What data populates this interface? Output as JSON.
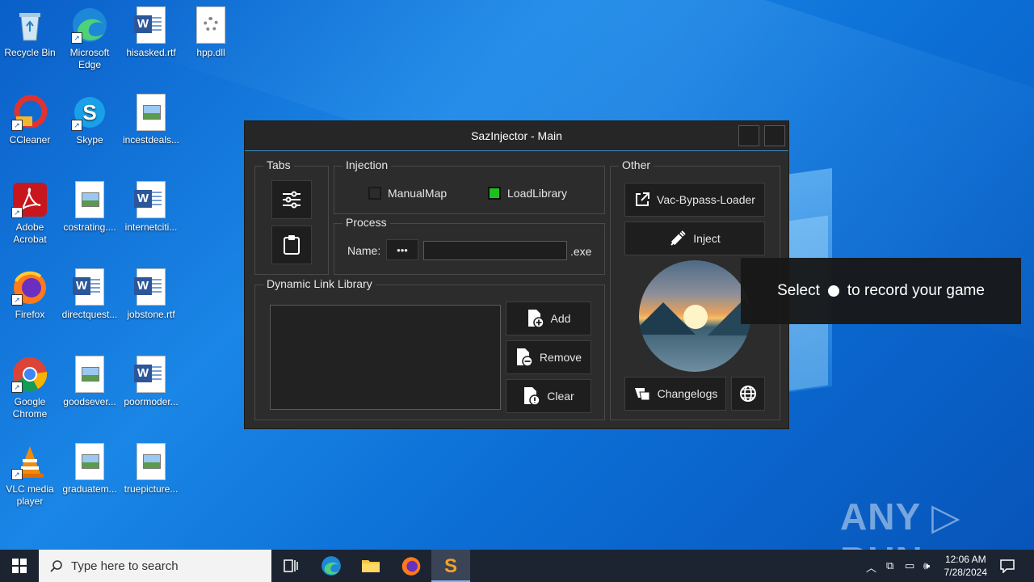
{
  "desktop": {
    "icons": [
      {
        "label": "Recycle Bin"
      },
      {
        "label": "Microsoft Edge"
      },
      {
        "label": "hisasked.rtf"
      },
      {
        "label": "hpp.dll"
      },
      {
        "label": "CCleaner"
      },
      {
        "label": "Skype"
      },
      {
        "label": "incestdeals..."
      },
      {
        "label": "Adobe Acrobat"
      },
      {
        "label": "costrating...."
      },
      {
        "label": "internetciti..."
      },
      {
        "label": "Firefox"
      },
      {
        "label": "directquest..."
      },
      {
        "label": "jobstone.rtf"
      },
      {
        "label": "Google Chrome"
      },
      {
        "label": "goodsever..."
      },
      {
        "label": "poormoder..."
      },
      {
        "label": "VLC media player"
      },
      {
        "label": "graduatem..."
      },
      {
        "label": "truepicture..."
      }
    ]
  },
  "window": {
    "title": "SazInjector - Main",
    "tabs_group": {
      "label": "Tabs"
    },
    "injection": {
      "label": "Injection",
      "manualmap": {
        "label": "ManualMap",
        "checked": false
      },
      "loadlibrary": {
        "label": "LoadLibrary",
        "checked": true
      }
    },
    "process": {
      "label": "Process",
      "name_label": "Name:",
      "browse_label": "•••",
      "name_value": "",
      "suffix": ".exe"
    },
    "dll": {
      "label": "Dynamic Link Library",
      "add": "Add",
      "remove": "Remove",
      "clear": "Clear"
    },
    "other": {
      "label": "Other",
      "vac": "Vac-Bypass-Loader",
      "inject": "Inject",
      "changelogs": "Changelogs"
    }
  },
  "toast": {
    "before": "Select",
    "after": "to record your game"
  },
  "watermark": "ANY ▷ RUN",
  "taskbar": {
    "search_placeholder": "Type here to search",
    "time": "12:06 AM",
    "date": "7/28/2024"
  },
  "colors": {
    "accent": "#3a8cc0",
    "checkbox_on": "#1fbf1f",
    "window_bg": "#2c2c2c"
  }
}
